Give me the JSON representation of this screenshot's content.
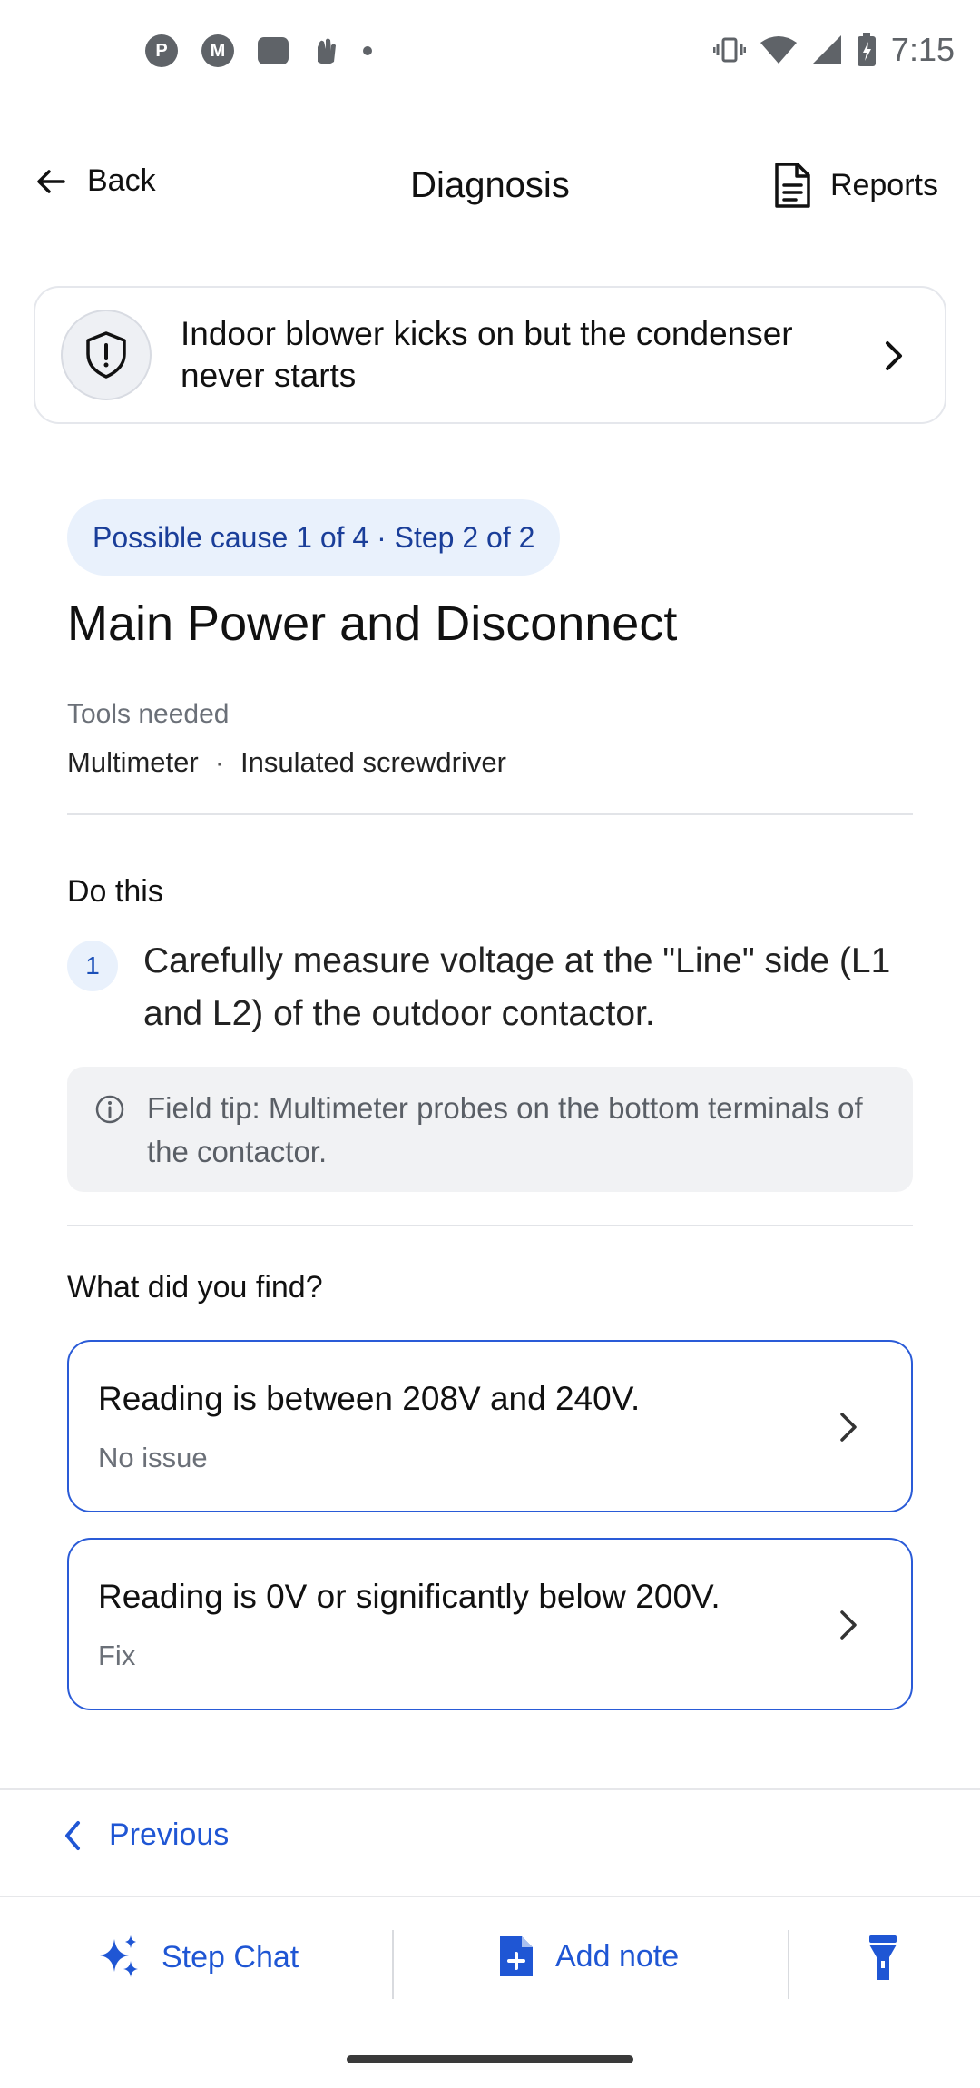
{
  "status_bar": {
    "time": "7:15",
    "left_icons": [
      "p-notification-icon",
      "motorola-icon",
      "wallet-icon",
      "hand-icon",
      "more-dot"
    ],
    "right_icons": [
      "vibrate-icon",
      "wifi-icon",
      "signal-icon",
      "battery-charging-icon"
    ]
  },
  "header": {
    "back_label": "Back",
    "title": "Diagnosis",
    "reports_label": "Reports"
  },
  "issue": {
    "text": "Indoor blower kicks on but the condenser never starts"
  },
  "step": {
    "badge": "Possible cause 1 of 4 · Step 2 of 2",
    "title": "Main Power and Disconnect",
    "tools_label": "Tools needed",
    "tools": [
      "Multimeter",
      "Insulated screwdriver"
    ],
    "tools_separator": "·"
  },
  "instructions": {
    "section_label": "Do this",
    "items": [
      {
        "number": "1",
        "text": "Carefully measure voltage at the \"Line\" side (L1 and L2) of the outdoor contactor."
      }
    ],
    "tip": "Field tip: Multimeter probes on the bottom terminals of the contactor."
  },
  "findings": {
    "section_label": "What did you find?",
    "options": [
      {
        "title": "Reading is between 208V and 240V.",
        "subtitle": "No issue"
      },
      {
        "title": "Reading is 0V or significantly below 200V.",
        "subtitle": "Fix"
      }
    ]
  },
  "navigation": {
    "previous_label": "Previous"
  },
  "bottom_bar": {
    "step_chat_label": "Step Chat",
    "add_note_label": "Add note"
  },
  "colors": {
    "accent": "#1f56d4",
    "card_border": "#2a5bd7",
    "badge_bg": "#e9f1fc",
    "badge_text": "#1a3e99",
    "tip_bg": "#f1f2f4"
  }
}
